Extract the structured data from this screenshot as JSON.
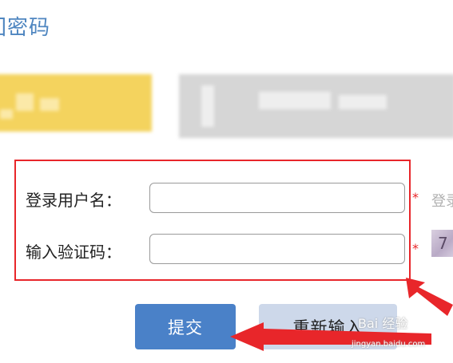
{
  "page": {
    "title": "回密码"
  },
  "form": {
    "username_label": "登录用户名：",
    "username_value": "",
    "captcha_label": "输入验证码：",
    "captcha_value": "",
    "required_mark": "*",
    "username_hint": "登录",
    "captcha_text": "7"
  },
  "buttons": {
    "submit": "提交",
    "reset": "重新输入"
  },
  "watermark": {
    "brand": "Bai 经验",
    "url": "jingyan.baidu.com"
  },
  "colors": {
    "accent": "#4a81c8",
    "highlight": "#e8262a",
    "title": "#4f86c0"
  }
}
